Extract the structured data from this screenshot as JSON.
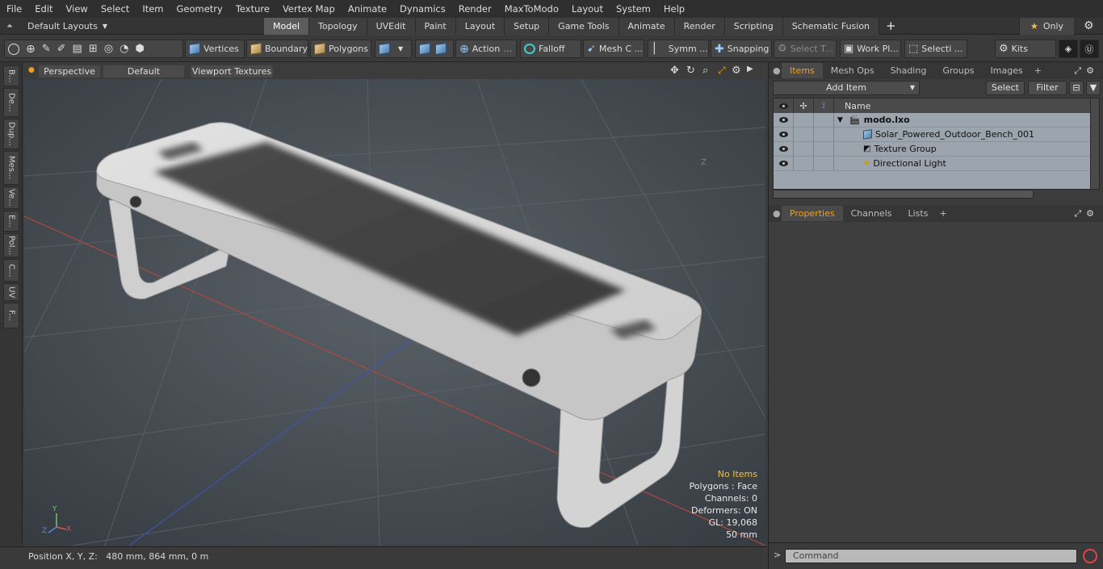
{
  "menu": [
    "File",
    "Edit",
    "View",
    "Select",
    "Item",
    "Geometry",
    "Texture",
    "Vertex Map",
    "Animate",
    "Dynamics",
    "Render",
    "MaxToModo",
    "Layout",
    "System",
    "Help"
  ],
  "layout_selector": "Default Layouts",
  "mode_tabs": [
    "Model",
    "Topology",
    "UVEdit",
    "Paint",
    "Layout",
    "Setup",
    "Game Tools",
    "Animate",
    "Render",
    "Scripting",
    "Schematic Fusion"
  ],
  "active_mode_tab": "Model",
  "only_label": "Only",
  "toolbar": {
    "vertices": "Vertices",
    "boundary": "Boundary",
    "polygons": "Polygons",
    "action": "Action",
    "falloff": "Falloff",
    "mesh_c": "Mesh C ...",
    "symm": "Symm ...",
    "snapping": "Snapping",
    "select_t": "Select T...",
    "work_pl": "Work Pl...",
    "selecti": "Selecti ...",
    "kits": "Kits"
  },
  "left_tabs": [
    "B...",
    "De...",
    "Dup...",
    "Mes...",
    "Ve...",
    "E...",
    "Pol...",
    "C...",
    "UV",
    "F..."
  ],
  "viewport": {
    "perspective": "Perspective",
    "default": "Default",
    "viewport_textures": "Viewport Textures",
    "axis_z_label": "Z",
    "axes": {
      "x": "X",
      "y": "Y",
      "z": "Z"
    },
    "stats": {
      "no_items": "No Items",
      "polygons": "Polygons : Face",
      "channels": "Channels: 0",
      "deformers": "Deformers: ON",
      "gl": "GL: 19,068",
      "scale": "50 mm"
    }
  },
  "status": "Position X, Y, Z:   480 mm, 864 mm, 0 m",
  "items_panel": {
    "tabs": [
      "Items",
      "Mesh Ops",
      "Shading",
      "Groups",
      "Images"
    ],
    "active_tab": "Items",
    "add_item": "Add Item",
    "select": "Select",
    "filter": "Filter",
    "name_header": "Name",
    "rows": [
      {
        "label": "modo.lxo",
        "bold": true,
        "indent": 0
      },
      {
        "label": "Solar_Powered_Outdoor_Bench_001",
        "bold": false,
        "indent": 1
      },
      {
        "label": "Texture Group",
        "bold": false,
        "indent": 1
      },
      {
        "label": "Directional Light",
        "bold": false,
        "indent": 1
      }
    ]
  },
  "properties_panel": {
    "tabs": [
      "Properties",
      "Channels",
      "Lists"
    ],
    "active_tab": "Properties"
  },
  "command": {
    "placeholder": "Command",
    "prompt": ">"
  }
}
